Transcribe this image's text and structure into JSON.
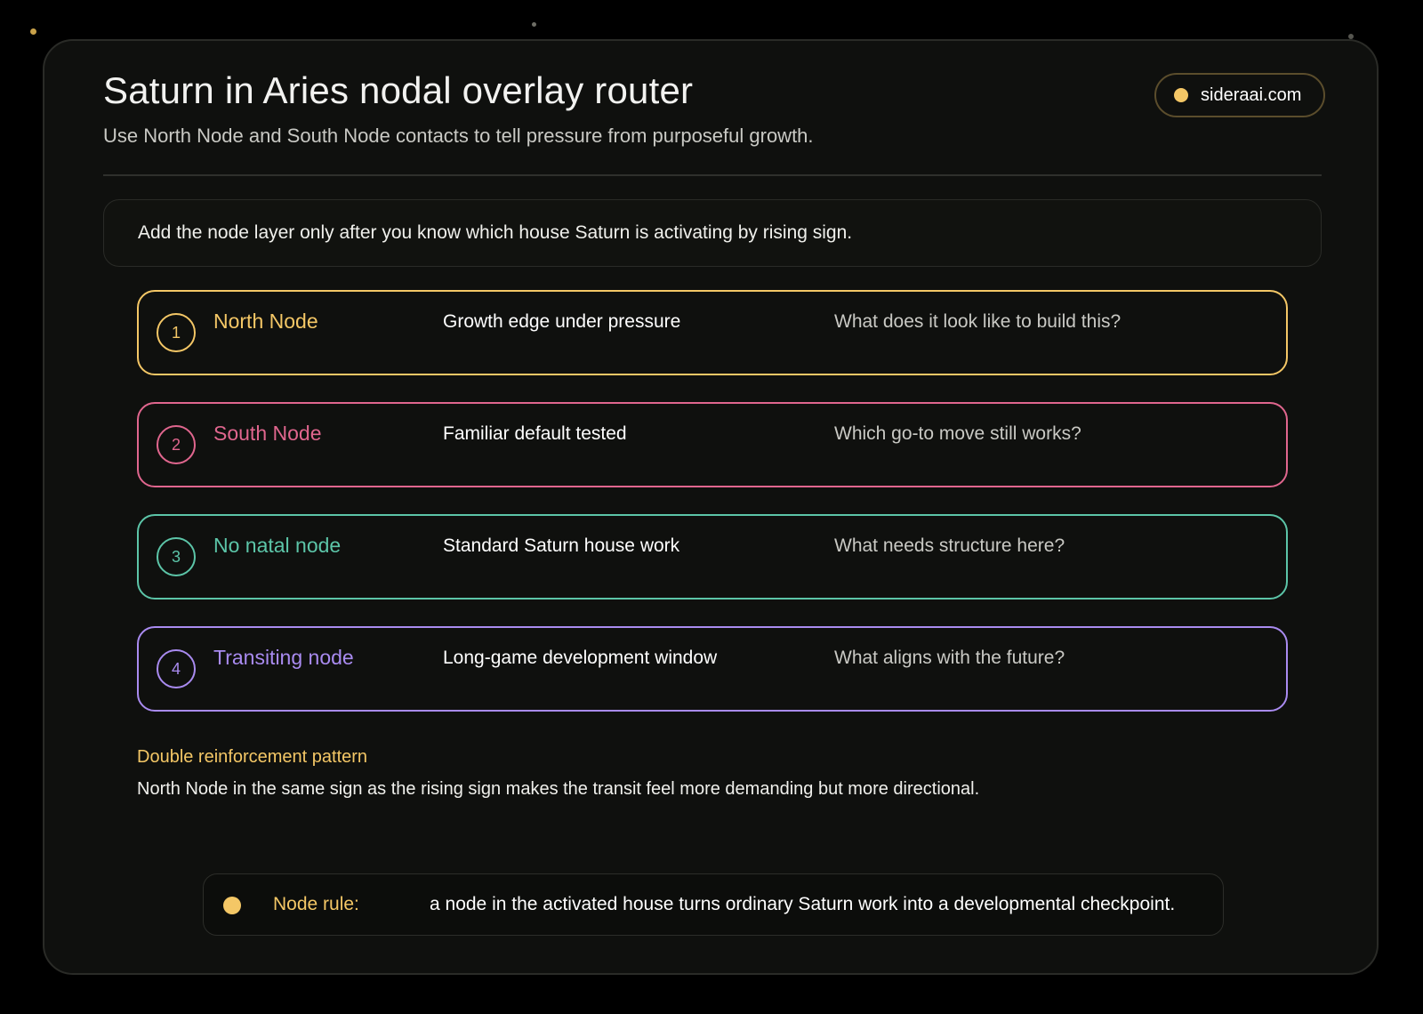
{
  "header": {
    "title": "Saturn in Aries nodal overlay router",
    "subtitle": "Use North Node and South Node contacts to tell pressure from purposeful growth.",
    "site": "sideraai.com",
    "site_icon": "dot-icon"
  },
  "note": "Add the node layer only after you know which house Saturn is activating by rising sign.",
  "nodes": [
    {
      "number": "1",
      "name": "North Node",
      "effect": "Growth edge under pressure",
      "question": "What does it look like to build this?",
      "color": "#f4c766"
    },
    {
      "number": "2",
      "name": "South Node",
      "effect": "Familiar default tested",
      "question": "Which go-to move still works?",
      "color": "#e0668e"
    },
    {
      "number": "3",
      "name": "No natal node",
      "effect": "Standard Saturn house work",
      "question": "What needs structure here?",
      "color": "#5cc5a8"
    },
    {
      "number": "4",
      "name": "Transiting node",
      "effect": "Long-game development window",
      "question": "What aligns with the future?",
      "color": "#a98bf0"
    }
  ],
  "pattern": {
    "title": "Double reinforcement pattern",
    "text": "North Node in the same sign as the rising sign makes the transit feel more demanding but more directional."
  },
  "rule": {
    "label": "Node rule:",
    "text": "a node in the activated house turns ordinary Saturn work into a developmental checkpoint."
  },
  "colors": {
    "background": "#000000",
    "card": "#0f100e",
    "accent": "#f4c766"
  }
}
